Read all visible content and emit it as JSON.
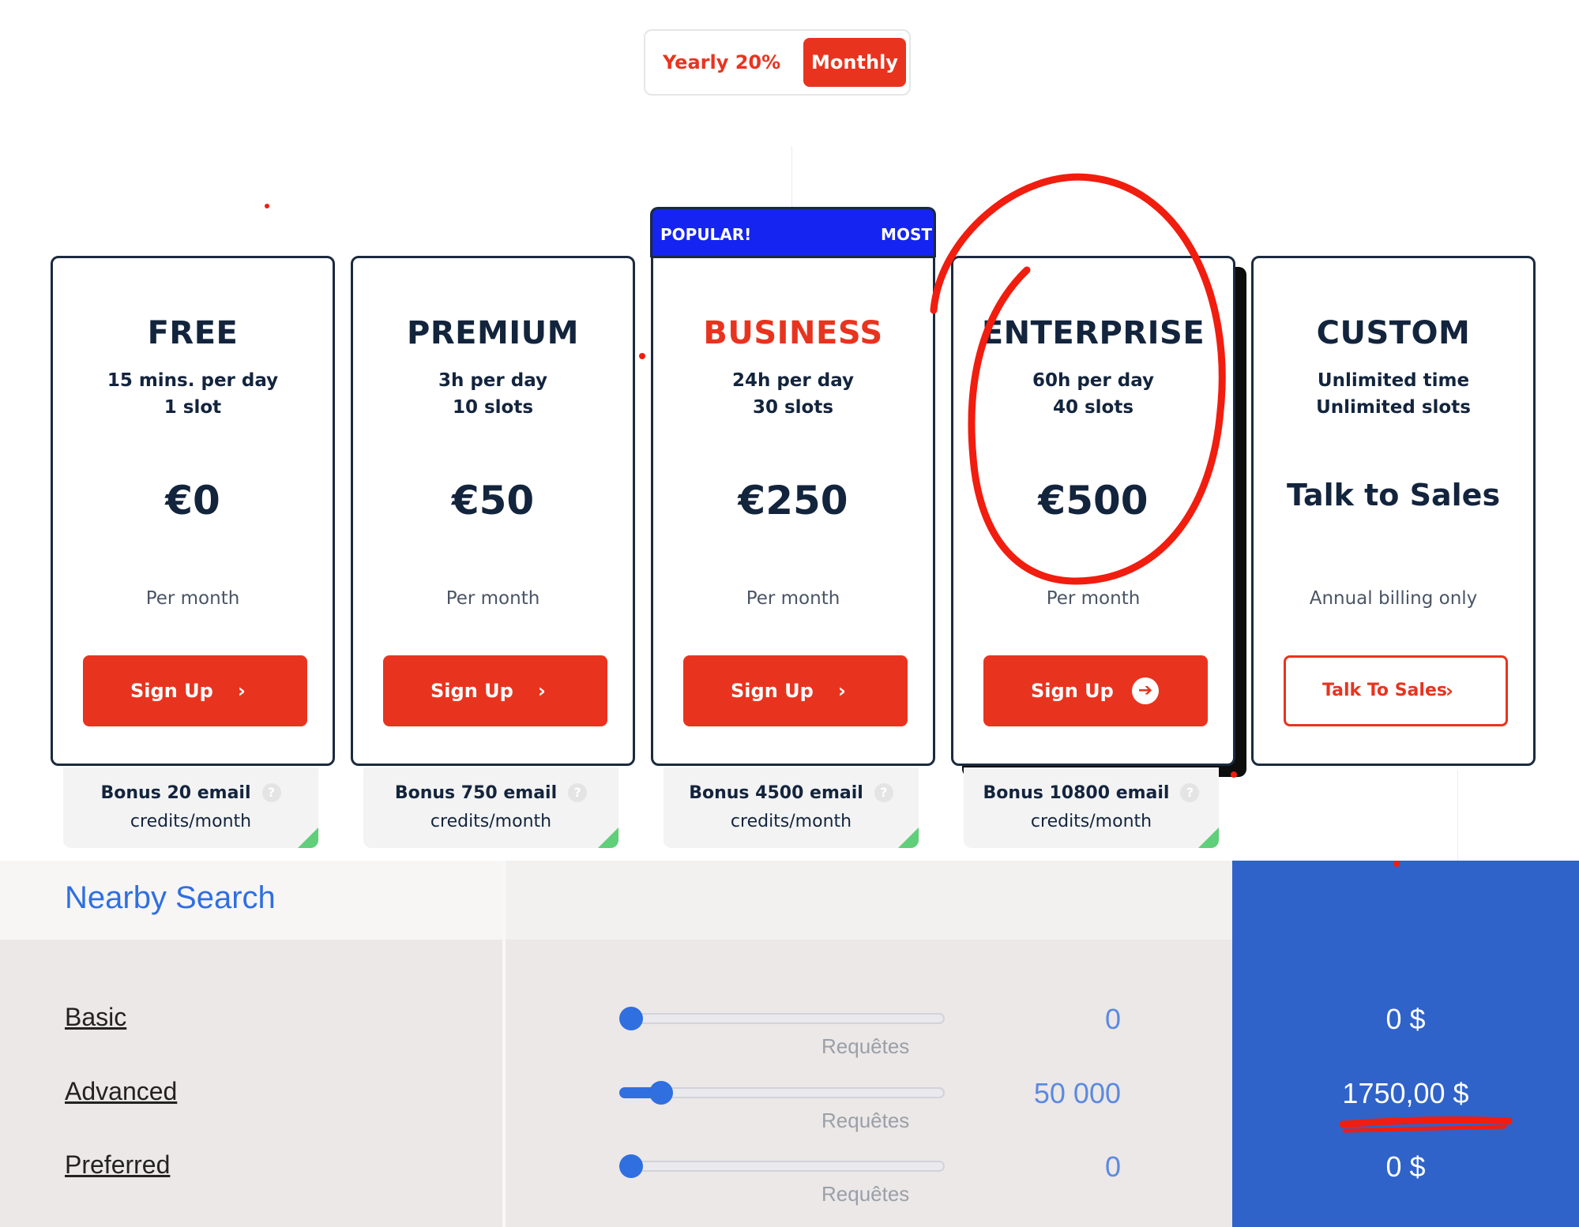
{
  "billing_toggle": {
    "yearly_label": "Yearly 20%",
    "monthly_label": "Monthly",
    "selected": "Monthly"
  },
  "popular_badge": {
    "left_text": "POPULAR!",
    "right_text": "MOST"
  },
  "plans": [
    {
      "name": "FREE",
      "line1": "15 mins. per day",
      "line2": "1 slot",
      "price": "€0",
      "note": "Per month",
      "button": "Sign Up",
      "bonus_title": "Bonus 20 email",
      "bonus_sub": "credits/month"
    },
    {
      "name": "PREMIUM",
      "line1": "3h per day",
      "line2": "10 slots",
      "price": "€50",
      "note": "Per month",
      "button": "Sign Up",
      "bonus_title": "Bonus 750 email",
      "bonus_sub": "credits/month"
    },
    {
      "name": "BUSINESS",
      "line1": "24h per day",
      "line2": "30 slots",
      "price": "€250",
      "note": "Per month",
      "button": "Sign Up",
      "bonus_title": "Bonus 4500 email",
      "bonus_sub": "credits/month"
    },
    {
      "name": "ENTERPRISE",
      "line1": "60h per day",
      "line2": "40 slots",
      "price": "€500",
      "note": "Per month",
      "button": "Sign Up",
      "bonus_title": "Bonus 10800 email",
      "bonus_sub": "credits/month"
    },
    {
      "name": "CUSTOM",
      "line1": "Unlimited time",
      "line2": "Unlimited slots",
      "price": "Talk to Sales",
      "note": "Annual billing only",
      "button": "Talk To Sales"
    }
  ],
  "colors": {
    "accent_red": "#e8341f",
    "navy": "#13243d",
    "popular_blue": "#1524f0",
    "google_blue": "#2f6fe0",
    "panel_blue": "#2f63c9",
    "bonus_green": "#5fcf7a"
  },
  "icons": {
    "chevron": "chevron-right-icon",
    "circle_arrow": "arrow-circle-right-icon",
    "help": "help-circle-icon"
  },
  "nearby_search": {
    "title": "Nearby Search",
    "rows": [
      {
        "label": "Basic",
        "slider_fraction": 0.0,
        "unit": "Requêtes",
        "count": "0",
        "price": "0 $"
      },
      {
        "label": "Advanced",
        "slider_fraction": 0.1,
        "unit": "Requêtes",
        "count": "50 000",
        "price": "1750,00 $"
      },
      {
        "label": "Preferred",
        "slider_fraction": 0.0,
        "unit": "Requêtes",
        "count": "0",
        "price": "0 $"
      }
    ]
  }
}
